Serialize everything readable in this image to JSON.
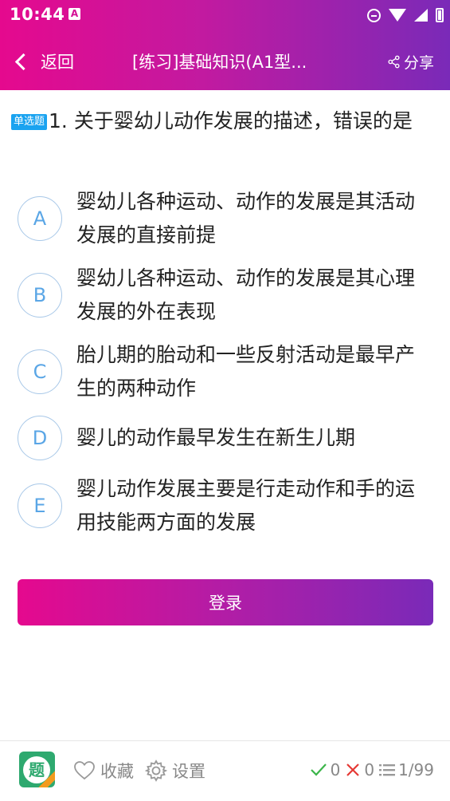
{
  "status_bar": {
    "time": "10:44",
    "notif_icon": "A"
  },
  "nav": {
    "back_label": "返回",
    "title": "[练习]基础知识(A1型...",
    "share_label": "分享"
  },
  "question": {
    "badge": "单选题",
    "text": "1. 关于婴幼儿动作发展的描述，错误的是",
    "options": [
      {
        "letter": "A",
        "text": "婴幼儿各种运动、动作的发展是其活动发展的直接前提"
      },
      {
        "letter": "B",
        "text": "婴幼儿各种运动、动作的发展是其心理发展的外在表现"
      },
      {
        "letter": "C",
        "text": "胎儿期的胎动和一些反射活动是最早产生的两种动作"
      },
      {
        "letter": "D",
        "text": "婴儿的动作最早发生在新生儿期"
      },
      {
        "letter": "E",
        "text": "婴儿动作发展主要是行走动作和手的运用技能两方面的发展"
      }
    ]
  },
  "login_label": "登录",
  "footer": {
    "logo_char": "题",
    "favorite_label": "收藏",
    "settings_label": "设置",
    "correct_count": "0",
    "wrong_count": "0",
    "progress": "1/99"
  },
  "colors": {
    "header_start": "#e5098e",
    "header_end": "#7a2ab8",
    "badge": "#1aa3f0",
    "option_circle_text": "#5aa6e6",
    "correct": "#3cb54a",
    "wrong": "#e53935"
  }
}
